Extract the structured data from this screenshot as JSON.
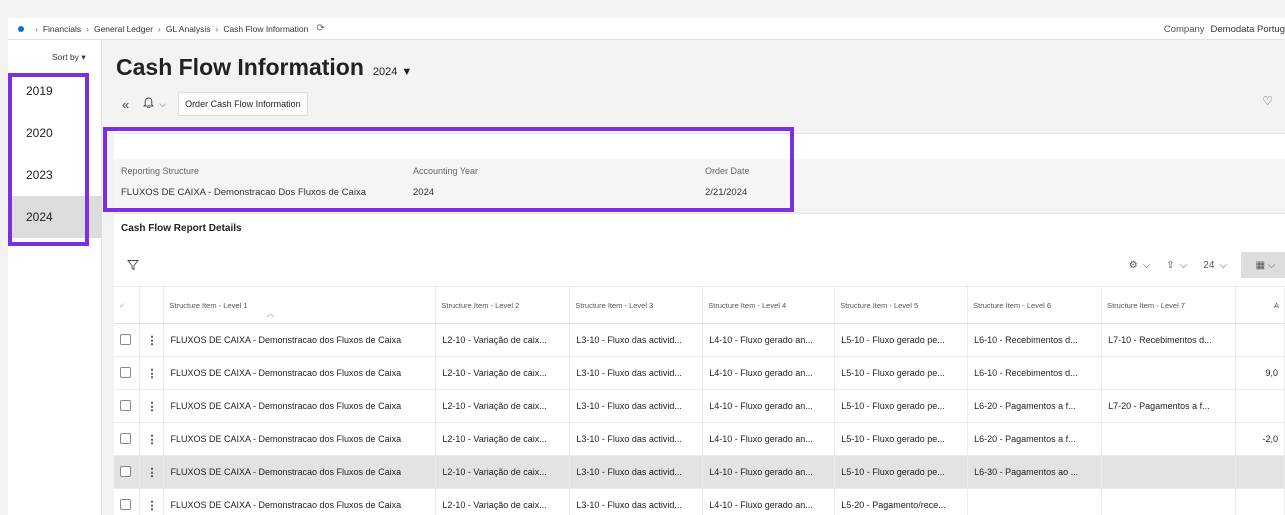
{
  "breadcrumb": {
    "items": [
      "Financials",
      "General Ledger",
      "GL Analysis",
      "Cash Flow Information"
    ]
  },
  "company": {
    "label": "Company",
    "value": "Demodata Portug"
  },
  "sidebar": {
    "sort_label": "Sort by",
    "years": [
      "2019",
      "2020",
      "2023",
      "2024"
    ],
    "selected": "2024"
  },
  "page": {
    "title": "Cash Flow Information",
    "year": "2024"
  },
  "toolbar": {
    "order_button": "Order Cash Flow Information"
  },
  "header": {
    "fields": [
      {
        "label": "Reporting Structure",
        "value": "FLUXOS DE CAIXA - Demonstracao Dos Fluxos de Caixa"
      },
      {
        "label": "Accounting Year",
        "value": "2024"
      },
      {
        "label": "Order Date",
        "value": "2/21/2024"
      }
    ]
  },
  "details": {
    "title": "Cash Flow Report Details",
    "page_size": "24",
    "columns": [
      "Structure Item - Level 1",
      "Structure Item - Level 2",
      "Structure Item - Level 3",
      "Structure Item - Level 4",
      "Structure Item - Level 5",
      "Structure Item - Level 6",
      "Structure Item - Level 7",
      "A"
    ],
    "rows": [
      [
        "FLUXOS DE CAIXA - Demonstracao dos Fluxos de Caixa",
        "L2-10 - Variação de caix...",
        "L3-10 - Fluxo das activid...",
        "L4-10 - Fluxo gerado an...",
        "L5-10 - Fluxo gerado pe...",
        "L6-10 - Recebimentos d...",
        "L7-10 - Recebimentos d...",
        ""
      ],
      [
        "FLUXOS DE CAIXA - Demonstracao dos Fluxos de Caixa",
        "L2-10 - Variação de caix...",
        "L3-10 - Fluxo das activid...",
        "L4-10 - Fluxo gerado an...",
        "L5-10 - Fluxo gerado pe...",
        "L6-10 - Recebimentos d...",
        "",
        "9,0"
      ],
      [
        "FLUXOS DE CAIXA - Demonstracao dos Fluxos de Caixa",
        "L2-10 - Variação de caix...",
        "L3-10 - Fluxo das activid...",
        "L4-10 - Fluxo gerado an...",
        "L5-10 - Fluxo gerado pe...",
        "L6-20 - Pagamentos a f...",
        "L7-20 - Pagamentos a f...",
        ""
      ],
      [
        "FLUXOS DE CAIXA - Demonstracao dos Fluxos de Caixa",
        "L2-10 - Variação de caix...",
        "L3-10 - Fluxo das activid...",
        "L4-10 - Fluxo gerado an...",
        "L5-10 - Fluxo gerado pe...",
        "L6-20 - Pagamentos a f...",
        "",
        "-2,0"
      ],
      [
        "FLUXOS DE CAIXA - Demonstracao dos Fluxos de Caixa",
        "L2-10 - Variação de caix...",
        "L3-10 - Fluxo das activid...",
        "L4-10 - Fluxo gerado an...",
        "L5-10 - Fluxo gerado pe...",
        "L6-30 - Pagamentos ao ...",
        "",
        ""
      ],
      [
        "FLUXOS DE CAIXA - Demonstracao dos Fluxos de Caixa",
        "L2-10 - Variação de caix...",
        "L3-10 - Fluxo das activid...",
        "L4-10 - Fluxo gerado an...",
        "L5-20 - Pagamento/rece...",
        "",
        "",
        ""
      ]
    ],
    "highlighted_row": 4
  },
  "colors": {
    "highlight": "#7b2fe0",
    "brand_dot": "#0a6fd6"
  },
  "icons": [
    "refresh-icon",
    "collapse-icon",
    "bell-icon",
    "heart-icon",
    "filter-icon",
    "settings-icon",
    "export-icon",
    "column-chooser-icon"
  ]
}
